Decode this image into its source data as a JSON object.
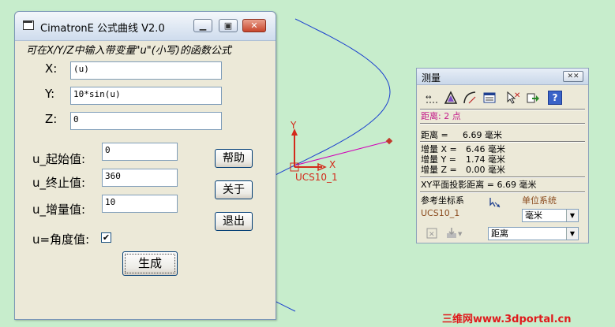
{
  "formula_window": {
    "title": "CimatronE 公式曲线 V2.0",
    "minimize_icon": "minimize-icon",
    "maximize_icon": "maximize-icon",
    "close_icon": "close-icon",
    "hint": "可在X/Y/Z中输入带变量\"u\"(小写)的函数公式",
    "x_label": "X:",
    "x_value": "(u)",
    "y_label": "Y:",
    "y_value": "10*sin(u)",
    "z_label": "Z:",
    "z_value": "0",
    "start_label": "u_起始值:",
    "start_value": "0",
    "end_label": "u_终止值:",
    "end_value": "360",
    "step_label": "u_增量值:",
    "step_value": "10",
    "degree_label": "u=角度值:",
    "degree_checked": true,
    "help_button": "帮助",
    "about_button": "关于",
    "exit_button": "退出",
    "generate_button": "生成"
  },
  "viewport": {
    "axis_y_label": "Y",
    "axis_x_label": "X",
    "ucs_label": "UCS10_1",
    "curve_color": "#1a3fcf",
    "measure_line_color": "#d100b8",
    "point_color": "#c0392b"
  },
  "measure_window": {
    "title": "测量",
    "close_icon": "close-icon",
    "tools": [
      "distance-tool-icon",
      "angle-tool-icon",
      "arc-tool-icon",
      "list-tool-icon",
      "clear-selection-icon",
      "export-icon",
      "help-icon"
    ],
    "mode_text": "距离:  2 点",
    "distance_label": "距离 =",
    "distance_value": "6.69 毫米",
    "dx_label": "增量 X =",
    "dx_value": "6.46 毫米",
    "dy_label": "增量 Y =",
    "dy_value": "1.74 毫米",
    "dz_label": "增量 Z =",
    "dz_value": "0.00 毫米",
    "xy_projection": "XY平面投影距离 = 6.69 毫米",
    "ref_cs_label": "参考坐标系",
    "ref_cs_value": "UCS10_1",
    "unit_system_label": "单位系统",
    "unit_value": "毫米",
    "mode_value": "距离"
  },
  "watermark": "三维网www.3dportal.cn"
}
